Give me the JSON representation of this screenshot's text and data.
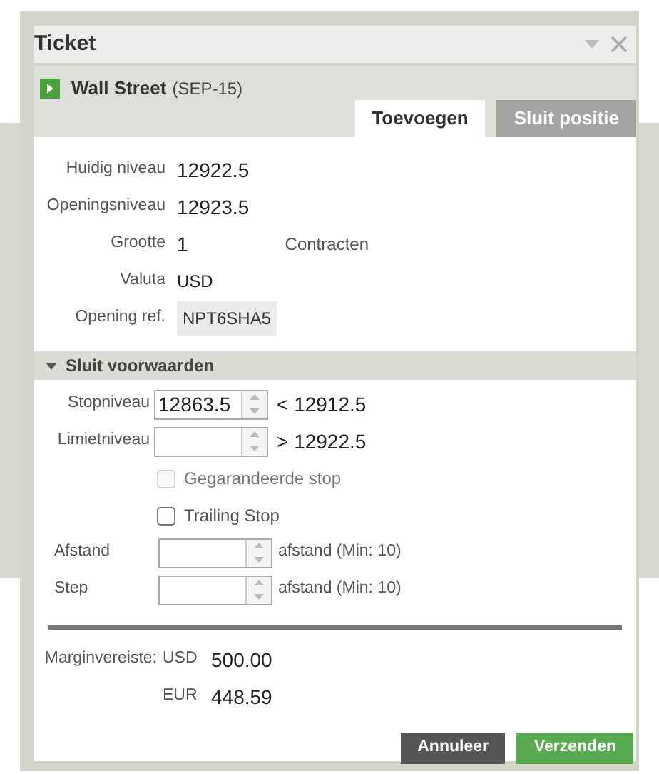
{
  "window": {
    "title": "Ticket"
  },
  "instrument": {
    "name": "Wall Street",
    "expiry": "(SEP-15)"
  },
  "tabs": [
    {
      "label": "Toevoegen",
      "selected": true
    },
    {
      "label": "Sluit positie",
      "selected": false
    }
  ],
  "details": [
    {
      "label": "Huidig niveau",
      "value": "12922.5",
      "kind": "number"
    },
    {
      "label": "Openingsniveau",
      "value": "12923.5",
      "kind": "number"
    },
    {
      "label": "Grootte",
      "value": "1",
      "unit": "Contracten",
      "kind": "number"
    },
    {
      "label": "Valuta",
      "value": "USD",
      "kind": "text"
    },
    {
      "label": "Opening ref.",
      "value": "NPT6SHA5",
      "kind": "ref"
    }
  ],
  "section": {
    "title": "Sluit voorwaarden",
    "expanded": true
  },
  "levels": [
    {
      "label": "Stopniveau",
      "value": "12863.5",
      "limit": "< 12912.5"
    },
    {
      "label": "Limietniveau",
      "limit": "> 12922.5"
    }
  ],
  "checkboxes": [
    {
      "label": "Gegarandeerde stop",
      "checked": false,
      "disabled": true
    },
    {
      "label": "Trailing Stop",
      "checked": false,
      "disabled": false
    }
  ],
  "trailing": [
    {
      "label": "Afstand",
      "hint": "afstand (Min: 10)"
    },
    {
      "label": "Step",
      "hint": "afstand (Min: 10)"
    }
  ],
  "margin": {
    "label": "Marginvereiste:",
    "amounts": [
      {
        "currency": "USD",
        "value": "500.00"
      },
      {
        "currency": "EUR",
        "value": "448.59"
      }
    ]
  },
  "buttons": [
    {
      "label": "Annuleer",
      "kind": "secondary"
    },
    {
      "label": "Verzenden",
      "kind": "primary"
    }
  ]
}
